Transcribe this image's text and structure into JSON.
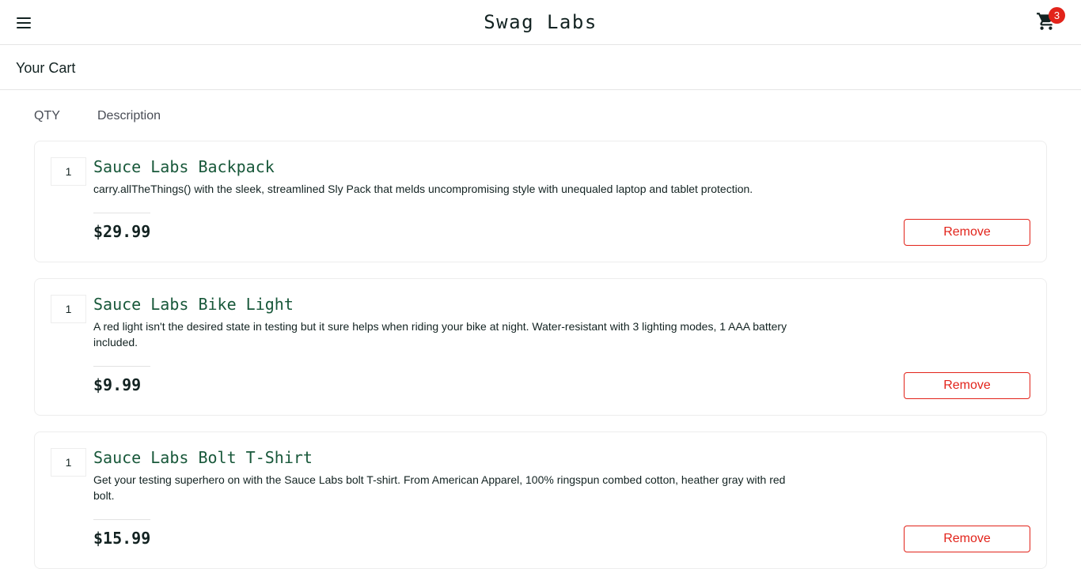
{
  "header": {
    "menu_icon": "hamburger-menu-icon",
    "app_title": "Swag Labs",
    "cart_icon": "shopping-cart-icon",
    "cart_count": "3"
  },
  "subheader": {
    "title": "Your Cart"
  },
  "list_header": {
    "qty": "QTY",
    "description": "Description"
  },
  "colors": {
    "item_name": "#18583a",
    "remove": "#e2231a",
    "badge": "#e2231a"
  },
  "items": [
    {
      "quantity": "1",
      "name": "Sauce Labs Backpack",
      "description": "carry.allTheThings() with the sleek, streamlined Sly Pack that melds uncompromising style with unequaled laptop and tablet protection.",
      "price": "$29.99",
      "remove_label": "Remove"
    },
    {
      "quantity": "1",
      "name": "Sauce Labs Bike Light",
      "description": "A red light isn't the desired state in testing but it sure helps when riding your bike at night. Water-resistant with 3 lighting modes, 1 AAA battery included.",
      "price": "$9.99",
      "remove_label": "Remove"
    },
    {
      "quantity": "1",
      "name": "Sauce Labs Bolt T-Shirt",
      "description": "Get your testing superhero on with the Sauce Labs bolt T-shirt. From American Apparel, 100% ringspun combed cotton, heather gray with red bolt.",
      "price": "$15.99",
      "remove_label": "Remove"
    }
  ]
}
